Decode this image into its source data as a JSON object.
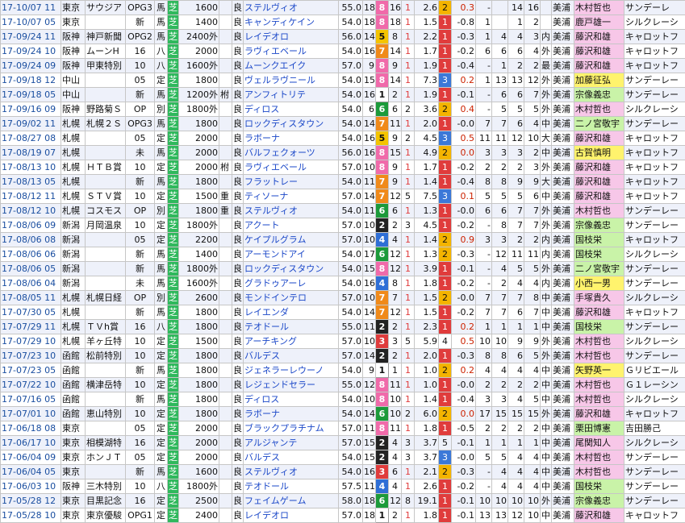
{
  "gate_colors": {
    "1": "#ffffff",
    "2": "#222222",
    "3": "#e03c3c",
    "4": "#2f6fd6",
    "5": "#f4c400",
    "6": "#1c9a3a",
    "7": "#f08a1a",
    "8": "#f06aaa"
  },
  "rows": [
    [
      "17-10/07 11",
      "東京",
      "サウジア",
      "OPG3",
      "馬",
      "芝",
      "1600",
      "",
      "良",
      "ステルヴィオ",
      "55.0",
      "18",
      "8",
      "16",
      "1",
      "2.6",
      "2",
      "0.3",
      "-",
      "",
      "14",
      "16",
      "",
      "美浦",
      "木村哲也",
      "サンデーレ"
    ],
    [
      "17-10/07 05",
      "東京",
      "",
      "新",
      "馬",
      "芝",
      "1400",
      "",
      "良",
      "キャンディケイン",
      "54.0",
      "18",
      "8",
      "18",
      "1",
      "1.5",
      "1",
      "-0.8",
      "1",
      "",
      "1",
      "2",
      "",
      "美浦",
      "鹿戸雄一",
      "シルクレーシ"
    ],
    [
      "17-09/24 11",
      "阪神",
      "神戸新聞",
      "OPG2",
      "馬",
      "芝",
      "2400外",
      "",
      "良",
      "レイデオロ",
      "56.0",
      "14",
      "5",
      "8",
      "1",
      "2.2",
      "1",
      "-0.3",
      "1",
      "4",
      "4",
      "3",
      "内",
      "美浦",
      "藤沢和雄",
      "キャロットフ"
    ],
    [
      "17-09/24 10",
      "阪神",
      "ムーンH",
      "16",
      "八",
      "芝",
      "2000",
      "",
      "良",
      "ラヴィエベール",
      "54.0",
      "16",
      "7",
      "14",
      "1",
      "1.7",
      "1",
      "-0.2",
      "6",
      "6",
      "6",
      "4",
      "外",
      "美浦",
      "藤沢和雄",
      "キャロットフ"
    ],
    [
      "17-09/24 09",
      "阪神",
      "甲東特別",
      "10",
      "八",
      "芝",
      "1600外",
      "",
      "良",
      "ムーンクエイク",
      "57.0",
      "9",
      "8",
      "9",
      "1",
      "1.9",
      "1",
      "-0.4",
      "-",
      "1",
      "2",
      "2",
      "最",
      "美浦",
      "藤沢和雄",
      "キャロットフ"
    ],
    [
      "17-09/18 12",
      "中山",
      "",
      "05",
      "定",
      "芝",
      "1800",
      "",
      "良",
      "ヴェルラヴニール",
      "54.0",
      "15",
      "8",
      "14",
      "1",
      "7.3",
      "3",
      "0.2",
      "1",
      "13",
      "13",
      "12",
      "外",
      "美浦",
      "加藤征弘",
      "サンデーレー"
    ],
    [
      "17-09/18 05",
      "中山",
      "",
      "新",
      "馬",
      "芝",
      "1200外",
      "柎",
      "良",
      "アンフィトリテ",
      "54.0",
      "16",
      "1",
      "2",
      "1",
      "1.9",
      "1",
      "-0.1",
      "-",
      "6",
      "6",
      "7",
      "外",
      "美浦",
      "宗像義忠",
      "サンデーレー"
    ],
    [
      "17-09/16 09",
      "阪神",
      "野路菊Ｓ",
      "OP",
      "別",
      "芝",
      "1800外",
      "",
      "良",
      "ディロス",
      "54.0",
      "6",
      "6",
      "6",
      "2",
      "3.6",
      "2",
      "0.4",
      "-",
      "5",
      "5",
      "5",
      "外",
      "美浦",
      "木村哲也",
      "シルクレーシ"
    ],
    [
      "17-09/02 11",
      "札幌",
      "札幌２Ｓ",
      "OPG3",
      "馬",
      "芝",
      "1800",
      "",
      "良",
      "ロックディスタウン",
      "54.0",
      "14",
      "7",
      "11",
      "1",
      "2.0",
      "1",
      "-0.0",
      "7",
      "7",
      "6",
      "4",
      "中",
      "美浦",
      "二ノ宮敬宇",
      "サンデーレー"
    ],
    [
      "17-08/27 08",
      "札幌",
      "",
      "05",
      "定",
      "芝",
      "2000",
      "",
      "良",
      "ラボーナ",
      "54.0",
      "16",
      "5",
      "9",
      "2",
      "4.5",
      "3",
      "0.5",
      "11",
      "11",
      "12",
      "10",
      "大",
      "美浦",
      "藤沢和雄",
      "キャロットフ"
    ],
    [
      "17-08/19 07",
      "札幌",
      "",
      "未",
      "馬",
      "芝",
      "2000",
      "",
      "良",
      "バルフェクォーツ",
      "56.0",
      "16",
      "8",
      "15",
      "1",
      "4.9",
      "2",
      "0.0",
      "3",
      "3",
      "3",
      "2",
      "中",
      "美浦",
      "古賀慎明",
      "キャロットフ"
    ],
    [
      "17-08/13 10",
      "札幌",
      "ＨＴＢ賞",
      "10",
      "定",
      "芝",
      "2000",
      "柎",
      "良",
      "ラヴィエベール",
      "57.0",
      "10",
      "8",
      "9",
      "1",
      "1.7",
      "1",
      "-0.2",
      "2",
      "2",
      "2",
      "3",
      "外",
      "美浦",
      "藤沢和雄",
      "キャロットフ"
    ],
    [
      "17-08/13 05",
      "札幌",
      "",
      "新",
      "馬",
      "芝",
      "1800",
      "",
      "良",
      "フラットレー",
      "54.0",
      "11",
      "7",
      "9",
      "1",
      "1.4",
      "1",
      "-0.4",
      "8",
      "8",
      "9",
      "9",
      "大",
      "美浦",
      "藤沢和雄",
      "キャロットフ"
    ],
    [
      "17-08/12 11",
      "札幌",
      "ＳＴＶ賞",
      "10",
      "定",
      "芝",
      "1500",
      "重",
      "良",
      "ティソーナ",
      "57.0",
      "14",
      "7",
      "12",
      "5",
      "7.5",
      "3",
      "0.1",
      "5",
      "5",
      "5",
      "6",
      "中",
      "美浦",
      "藤沢和雄",
      "キャロットフ"
    ],
    [
      "17-08/12 10",
      "札幌",
      "コスモス",
      "OP",
      "別",
      "芝",
      "1800",
      "重",
      "良",
      "ステルヴィオ",
      "54.0",
      "11",
      "6",
      "6",
      "1",
      "1.3",
      "1",
      "-0.0",
      "6",
      "6",
      "7",
      "7",
      "外",
      "美浦",
      "木村哲也",
      "サンデーレー"
    ],
    [
      "17-08/06 09",
      "新潟",
      "月岡温泉",
      "10",
      "定",
      "芝",
      "1800外",
      "",
      "良",
      "アクート",
      "57.0",
      "10",
      "2",
      "2",
      "3",
      "4.5",
      "1",
      "-0.2",
      "-",
      "8",
      "7",
      "7",
      "外",
      "美浦",
      "宗像義忠",
      "サンデーレー"
    ],
    [
      "17-08/06 08",
      "新潟",
      "",
      "05",
      "定",
      "芝",
      "2200",
      "",
      "良",
      "ケイプルグラム",
      "57.0",
      "10",
      "4",
      "4",
      "1",
      "1.4",
      "2",
      "0.9",
      "3",
      "3",
      "2",
      "2",
      "内",
      "美浦",
      "国枝栄",
      "キャロットフ"
    ],
    [
      "17-08/06 06",
      "新潟",
      "",
      "新",
      "馬",
      "芝",
      "1400",
      "",
      "良",
      "アーモンドアイ",
      "54.0",
      "17",
      "6",
      "12",
      "1",
      "1.3",
      "2",
      "-0.3",
      "-",
      "12",
      "11",
      "11",
      "内",
      "美浦",
      "国枝栄",
      "シルクレーシ"
    ],
    [
      "17-08/06 05",
      "新潟",
      "",
      "新",
      "馬",
      "芝",
      "1800外",
      "",
      "良",
      "ロックディスタウン",
      "54.0",
      "15",
      "8",
      "12",
      "1",
      "3.9",
      "1",
      "-0.1",
      "-",
      "4",
      "5",
      "5",
      "外",
      "美浦",
      "二ノ宮敬宇",
      "サンデーレー"
    ],
    [
      "17-08/06 04",
      "新潟",
      "",
      "未",
      "馬",
      "芝",
      "1600外",
      "",
      "良",
      "グラドゥアーレ",
      "54.0",
      "16",
      "4",
      "8",
      "1",
      "1.8",
      "1",
      "-0.2",
      "-",
      "2",
      "4",
      "4",
      "内",
      "美浦",
      "小西一男",
      "サンデーレー"
    ],
    [
      "17-08/05 11",
      "札幌",
      "札幌日経",
      "OP",
      "別",
      "芝",
      "2600",
      "",
      "良",
      "モンドインテロ",
      "57.0",
      "10",
      "7",
      "7",
      "1",
      "1.5",
      "2",
      "-0.0",
      "7",
      "7",
      "7",
      "8",
      "中",
      "美浦",
      "手塚貴久",
      "シルクレーシ"
    ],
    [
      "17-07/30 05",
      "札幌",
      "",
      "新",
      "馬",
      "芝",
      "1800",
      "",
      "良",
      "レイエンダ",
      "54.0",
      "14",
      "7",
      "12",
      "1",
      "1.5",
      "1",
      "-0.2",
      "7",
      "7",
      "6",
      "7",
      "中",
      "美浦",
      "藤沢和雄",
      "キャロットフ"
    ],
    [
      "17-07/29 11",
      "札幌",
      "ＴＶh賞",
      "16",
      "八",
      "芝",
      "1800",
      "",
      "良",
      "テオドール",
      "55.0",
      "11",
      "2",
      "2",
      "1",
      "2.3",
      "1",
      "0.2",
      "1",
      "1",
      "1",
      "1",
      "中",
      "美浦",
      "国枝栄",
      "サンデーレー"
    ],
    [
      "17-07/29 10",
      "札幌",
      "羊ヶ丘特",
      "10",
      "定",
      "芝",
      "1500",
      "",
      "良",
      "アーチキング",
      "57.0",
      "10",
      "3",
      "3",
      "5",
      "5.9",
      "4",
      "0.5",
      "10",
      "10",
      "9",
      "9",
      "外",
      "美浦",
      "木村哲也",
      "シルクレーシ"
    ],
    [
      "17-07/23 10",
      "函館",
      "松前特別",
      "10",
      "定",
      "芝",
      "1800",
      "",
      "良",
      "バルデス",
      "57.0",
      "14",
      "2",
      "2",
      "1",
      "2.0",
      "1",
      "-0.3",
      "8",
      "8",
      "6",
      "5",
      "外",
      "美浦",
      "木村哲也",
      "サンデーレー"
    ],
    [
      "17-07/23 05",
      "函館",
      "",
      "新",
      "馬",
      "芝",
      "1800",
      "",
      "良",
      "ジェネラーレウーノ",
      "54.0",
      "9",
      "1",
      "1",
      "1",
      "1.0",
      "2",
      "0.2",
      "4",
      "4",
      "4",
      "4",
      "中",
      "美浦",
      "矢野英一",
      "Ｇリビエール"
    ],
    [
      "17-07/22 10",
      "函館",
      "横津岳特",
      "10",
      "定",
      "芝",
      "1800",
      "",
      "良",
      "レジェンドセラー",
      "55.0",
      "12",
      "8",
      "11",
      "1",
      "1.0",
      "1",
      "-0.0",
      "2",
      "2",
      "2",
      "2",
      "中",
      "美浦",
      "木村哲也",
      "Ｇ１レーシン"
    ],
    [
      "17-07/16 05",
      "函館",
      "",
      "新",
      "馬",
      "芝",
      "1800",
      "",
      "良",
      "ディロス",
      "54.0",
      "10",
      "8",
      "10",
      "1",
      "1.4",
      "1",
      "-0.4",
      "3",
      "3",
      "4",
      "5",
      "中",
      "美浦",
      "木村哲也",
      "シルクレーシ"
    ],
    [
      "17-07/01 10",
      "函館",
      "恵山特別",
      "10",
      "定",
      "芝",
      "1800",
      "",
      "良",
      "ラボーナ",
      "54.0",
      "14",
      "6",
      "10",
      "2",
      "6.0",
      "2",
      "0.0",
      "17",
      "15",
      "15",
      "15",
      "外",
      "美浦",
      "藤沢和雄",
      "キャロットフ"
    ],
    [
      "17-06/18 08",
      "東京",
      "",
      "05",
      "定",
      "芝",
      "2000",
      "",
      "良",
      "ブラックプラチナム",
      "57.0",
      "11",
      "8",
      "11",
      "1",
      "1.8",
      "1",
      "-0.5",
      "2",
      "2",
      "2",
      "2",
      "中",
      "美浦",
      "栗田博憲",
      "吉田勝己"
    ],
    [
      "17-06/17 10",
      "東京",
      "相模湖特",
      "16",
      "定",
      "芝",
      "2000",
      "",
      "良",
      "アルジャンテ",
      "57.0",
      "15",
      "2",
      "4",
      "3",
      "3.7",
      "5",
      "-0.1",
      "1",
      "1",
      "1",
      "1",
      "中",
      "美浦",
      "尾関知人",
      "シルクレーシ"
    ],
    [
      "17-06/04 09",
      "東京",
      "ホンＪＴ",
      "05",
      "定",
      "芝",
      "2000",
      "",
      "良",
      "バルデス",
      "54.0",
      "15",
      "2",
      "4",
      "3",
      "3.7",
      "3",
      "-0.0",
      "5",
      "5",
      "4",
      "4",
      "中",
      "美浦",
      "木村哲也",
      "サンデーレー"
    ],
    [
      "17-06/04 05",
      "東京",
      "",
      "新",
      "馬",
      "芝",
      "1600",
      "",
      "良",
      "ステルヴィオ",
      "54.0",
      "16",
      "3",
      "6",
      "1",
      "2.1",
      "2",
      "-0.3",
      "-",
      "4",
      "4",
      "4",
      "中",
      "美浦",
      "木村哲也",
      "サンデーレー"
    ],
    [
      "17-06/03 10",
      "阪神",
      "三木特別",
      "10",
      "八",
      "芝",
      "1800外",
      "",
      "良",
      "テオドール",
      "57.5",
      "11",
      "4",
      "4",
      "1",
      "2.6",
      "1",
      "-0.2",
      "-",
      "4",
      "4",
      "4",
      "中",
      "美浦",
      "国枝栄",
      "サンデーレー"
    ],
    [
      "17-05/28 12",
      "東京",
      "目黒記念",
      "16",
      "定",
      "芝",
      "2500",
      "",
      "良",
      "フェイムゲーム",
      "58.0",
      "18",
      "6",
      "12",
      "8",
      "19.1",
      "1",
      "-0.1",
      "10",
      "10",
      "10",
      "10",
      "外",
      "美浦",
      "宗像義忠",
      "サンデーレー"
    ],
    [
      "17-05/28 10",
      "東京",
      "東京優駿",
      "OPG1",
      "定",
      "芝",
      "2400",
      "",
      "良",
      "レイデオロ",
      "57.0",
      "18",
      "1",
      "2",
      "1",
      "1.8",
      "1",
      "-0.1",
      "13",
      "13",
      "12",
      "10",
      "中",
      "美浦",
      "藤沢和雄",
      "キャロットフ"
    ]
  ]
}
